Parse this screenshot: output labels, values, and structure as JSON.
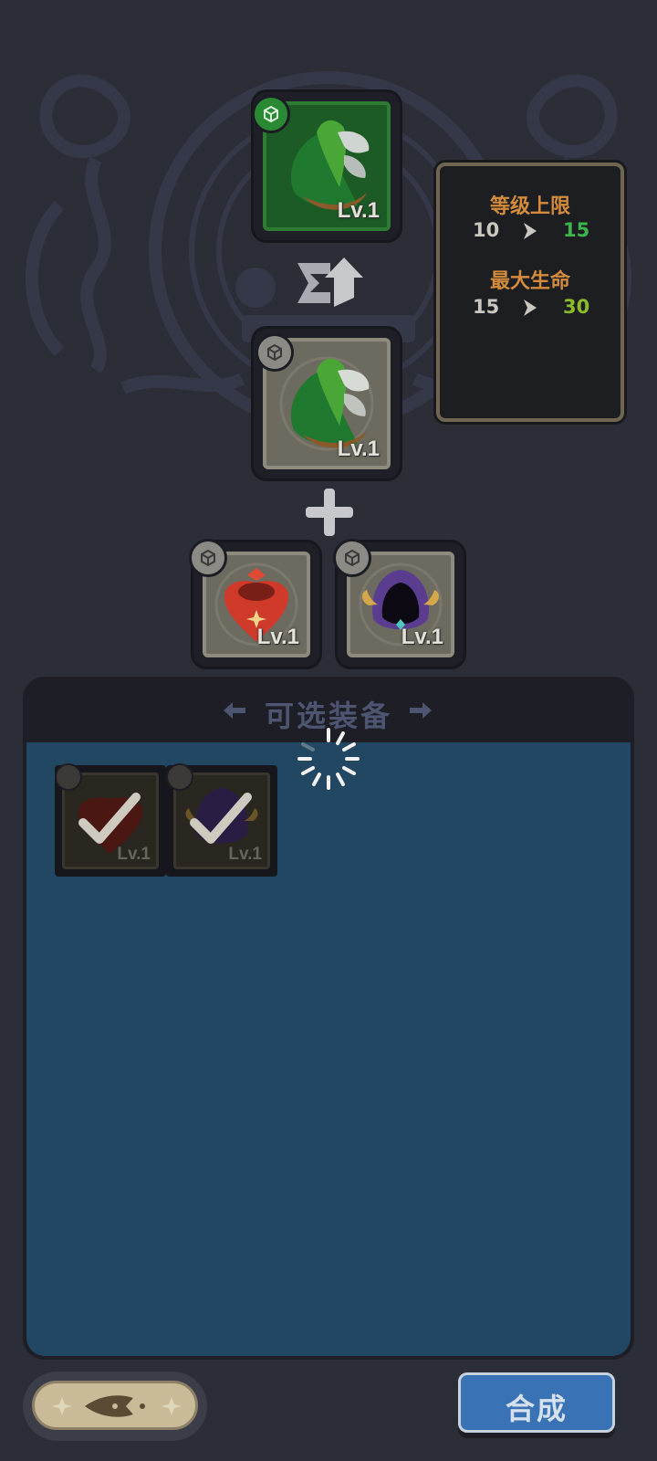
{
  "result_item": {
    "level_label": "Lv.1"
  },
  "base_item": {
    "level_label": "Lv.1"
  },
  "materials": [
    {
      "name": "scarf",
      "level_label": "Lv.1"
    },
    {
      "name": "hood",
      "level_label": "Lv.1"
    }
  ],
  "stats": {
    "level_cap": {
      "label": "等级上限",
      "from": "10",
      "to": "15"
    },
    "max_hp": {
      "label": "最大生命",
      "from": "15",
      "to": "30"
    }
  },
  "selectable_panel": {
    "title": "可选装备",
    "items": [
      {
        "name": "scarf",
        "level_label": "Lv.1",
        "selected": true
      },
      {
        "name": "hood",
        "level_label": "Lv.1",
        "selected": true
      }
    ]
  },
  "buttons": {
    "merge_label": "合成"
  },
  "colors": {
    "background": "#2b2d37",
    "stat_label": "#d48b3b",
    "stat_gain_green": "#3cb54a",
    "stat_gain_lime": "#8dba2a",
    "panel_body": "#224762",
    "merge_button": "#3a73b5"
  },
  "icons": {
    "upgrade": "upgrade-arrow-icon",
    "plus": "plus-icon",
    "check": "checkmark-icon",
    "loading": "loading-spinner-icon",
    "back": "back-arrow-icon"
  }
}
